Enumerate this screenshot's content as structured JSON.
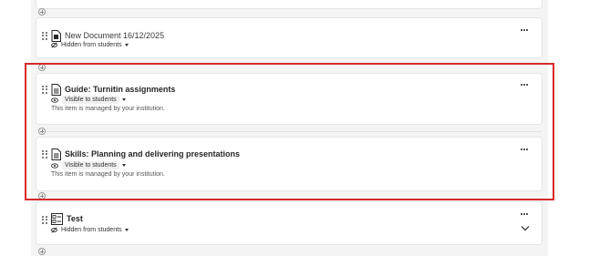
{
  "items": [
    {
      "title": "New Document 16/12/2025",
      "visibility": "Hidden from students",
      "icon": "new-document-icon"
    },
    {
      "title": "Guide: Turnitin assignments",
      "visibility": "Visible to students",
      "managed_note": "This item is managed by your institution.",
      "icon": "document-icon"
    },
    {
      "title": "Skills: Planning and delivering presentations",
      "visibility": "Visible to students",
      "managed_note": "This item is managed by your institution.",
      "icon": "document-icon"
    },
    {
      "title": "Test",
      "visibility": "Hidden from students",
      "icon": "test-icon"
    }
  ],
  "colors": {
    "highlight": "#d62a2a",
    "background": "#f4f4f4"
  }
}
